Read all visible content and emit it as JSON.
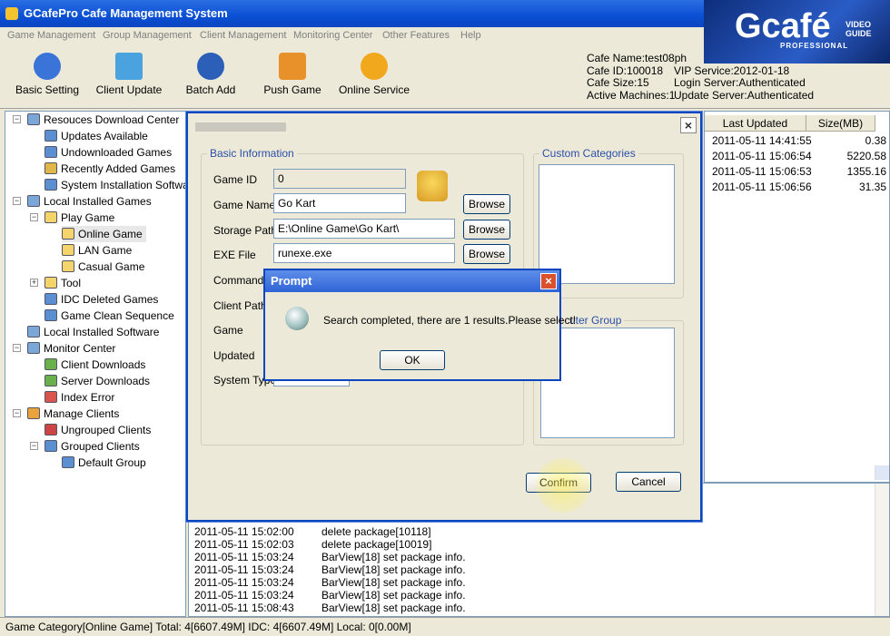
{
  "window": {
    "title": "GCafePro Cafe Management System"
  },
  "menu": [
    "Game Management",
    "Group Management",
    "Client Management",
    "Monitoring Center",
    "Other Features",
    "Help"
  ],
  "toolbar": [
    {
      "label": "Basic Setting",
      "icon": "gear-icon",
      "color": "#3a74d8"
    },
    {
      "label": "Client Update",
      "icon": "monitor-icon",
      "color": "#4aa3df"
    },
    {
      "label": "Batch Add",
      "icon": "magnifier-icon",
      "color": "#2b5fb8"
    },
    {
      "label": "Push Game",
      "icon": "push-icon",
      "color": "#e8912a"
    },
    {
      "label": "Online Service",
      "icon": "headset-icon",
      "color": "#f2a81d"
    }
  ],
  "cafe_info": {
    "name": "Cafe Name:test08ph",
    "id": "Cafe ID:100018",
    "vip": "VIP Service:2012-01-18",
    "size": "Cafe Size:15",
    "login": "Login Server:Authenticated",
    "machines": "Active Machines:1",
    "update": "Update Server:Authenticated"
  },
  "logo": {
    "brand": "Gcafé",
    "sub": "PROFESSIONAL",
    "tag1": "VIDEO",
    "tag2": "GUIDE"
  },
  "tree": [
    {
      "label": "Resouces Download Center",
      "icon": "download-center-icon"
    },
    {
      "label": "Updates Available",
      "icon": "update-icon"
    },
    {
      "label": "Undownloaded Games",
      "icon": "game-icon"
    },
    {
      "label": "Recently Added Games",
      "icon": "new-game-icon"
    },
    {
      "label": "System Installation Software",
      "icon": "software-icon"
    },
    {
      "label": "Local Installed Games",
      "icon": "local-games-icon"
    },
    {
      "label": "Play Game",
      "icon": "folder-icon"
    },
    {
      "label": "Online Game",
      "icon": "folder-icon"
    },
    {
      "label": "LAN Game",
      "icon": "folder-icon"
    },
    {
      "label": "Casual Game",
      "icon": "folder-icon"
    },
    {
      "label": "Tool",
      "icon": "folder-icon"
    },
    {
      "label": "IDC Deleted Games",
      "icon": "deleted-icon"
    },
    {
      "label": "Game Clean Sequence",
      "icon": "clean-icon"
    },
    {
      "label": "Local Installed Software",
      "icon": "software-icon"
    },
    {
      "label": "Monitor Center",
      "icon": "monitor-icon"
    },
    {
      "label": "Client Downloads",
      "icon": "client-download-icon"
    },
    {
      "label": "Server Downloads",
      "icon": "server-download-icon"
    },
    {
      "label": "Index Error",
      "icon": "error-icon"
    },
    {
      "label": "Manage Clients",
      "icon": "clients-icon"
    },
    {
      "label": "Ungrouped Clients",
      "icon": "client-icon"
    },
    {
      "label": "Grouped Clients",
      "icon": "client-group-icon"
    },
    {
      "label": "Default Group",
      "icon": "client-group-icon"
    }
  ],
  "grid": {
    "headers": [
      "Last Updated",
      "Size(MB)"
    ],
    "rows": [
      [
        "2011-05-11 14:41:55",
        "0.38"
      ],
      [
        "2011-05-11 15:06:54",
        "5220.58"
      ],
      [
        "2011-05-11 15:06:53",
        "1355.16"
      ],
      [
        "2011-05-11 15:06:56",
        "31.35"
      ]
    ]
  },
  "log": [
    [
      "2011-05-11 15:02:00",
      "delete package[10118]"
    ],
    [
      "2011-05-11 15:02:03",
      "delete package[10019]"
    ],
    [
      "2011-05-11 15:03:24",
      "BarView[18] set package info."
    ],
    [
      "2011-05-11 15:03:24",
      "BarView[18] set package info."
    ],
    [
      "2011-05-11 15:03:24",
      "BarView[18] set package info."
    ],
    [
      "2011-05-11 15:03:24",
      "BarView[18] set package info."
    ],
    [
      "2011-05-11 15:08:43",
      "BarView[18] set package info."
    ]
  ],
  "status": "Game Category[Online Game] Total: 4[6607.49M] IDC: 4[6607.49M] Local: 0[0.00M]",
  "dialog": {
    "basic_info": "Basic Information",
    "custom_categories": "Custom Categories",
    "computer_group": "uter Group",
    "labels": {
      "game_id": "Game ID",
      "game_name": "Game Name",
      "storage_path": "Storage Path",
      "exe_file": "EXE File",
      "command": "Command",
      "client_path": "Client Path",
      "game": "Game",
      "updated": "Updated",
      "system_type": "System Type"
    },
    "values": {
      "game_id": "0",
      "game_name": "Go Kart",
      "storage_path": "E:\\Online Game\\Go Kart\\",
      "exe_file": "runexe.exe"
    },
    "browse": "Browse",
    "confirm": "Confirm",
    "cancel": "Cancel"
  },
  "prompt": {
    "title": "Prompt",
    "message": "Search completed, there are 1 results.Please select!",
    "ok": "OK"
  }
}
